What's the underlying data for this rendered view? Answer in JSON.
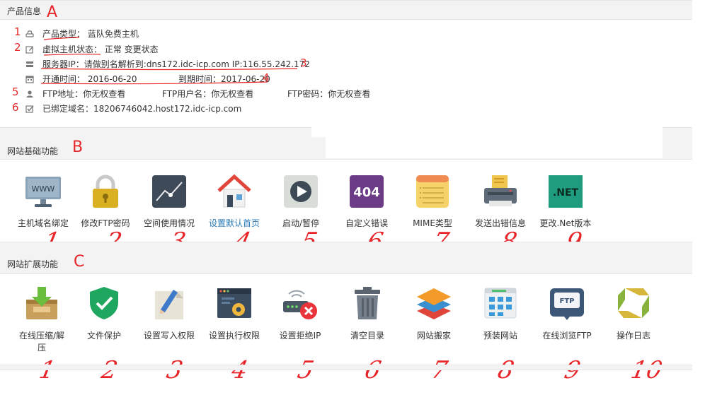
{
  "section_a": {
    "title": "产品信息",
    "letter": "A",
    "rows": [
      {
        "num": "1",
        "icon": "drive-icon",
        "text": "产品类型： 蓝队免费主机"
      },
      {
        "num": "2",
        "icon": "edit-icon",
        "text": "虚拟主机状态： 正常 变更状态"
      },
      {
        "num": "",
        "icon": "server-icon",
        "text": "服务器IP：请做别名解析到:dns172.idc-icp.com IP:116.55.242.172",
        "after_num": "3"
      },
      {
        "num": "",
        "icon": "calendar-icon",
        "text": "开通时间： 2016-06-20",
        "text2": "到期时间：2017-06-20",
        "after_num": "4"
      },
      {
        "num": "5",
        "icon": "user-icon",
        "text": "FTP地址：你无权查看",
        "text2": "FTP用户名：你无权查看",
        "text3": "FTP密码：你无权查看"
      },
      {
        "num": "6",
        "icon": "check-square-icon",
        "text": "已绑定域名：18206746042.host172.idc-icp.com"
      }
    ]
  },
  "section_b": {
    "title": "网站基础功能",
    "letter": "B",
    "tiles": [
      {
        "label": "主机域名绑定",
        "hand": "1",
        "icon": "www-monitor-icon",
        "link": false
      },
      {
        "label": "修改FTP密码",
        "hand": "2",
        "icon": "padlock-icon",
        "link": false
      },
      {
        "label": "空间使用情况",
        "hand": "3",
        "icon": "chart-icon",
        "link": false
      },
      {
        "label": "设置默认首页",
        "hand": "4",
        "icon": "home-icon",
        "link": true
      },
      {
        "label": "启动/暂停",
        "hand": "5",
        "icon": "play-icon",
        "link": false
      },
      {
        "label": "自定义错误",
        "hand": "6",
        "icon": "error-404-icon",
        "link": false
      },
      {
        "label": "MIME类型",
        "hand": "7",
        "icon": "notepad-icon",
        "link": false
      },
      {
        "label": "发送出错信息",
        "hand": "8",
        "icon": "printer-icon",
        "link": false
      },
      {
        "label": "更改.Net版本",
        "hand": "9",
        "icon": "dotnet-icon",
        "link": false
      }
    ],
    "tile_texts": {
      "www": "WWW",
      "e404": "404",
      "net": ".NET"
    }
  },
  "section_c": {
    "title": "网站扩展功能",
    "letter": "C",
    "tiles": [
      {
        "label": "在线压缩/解压",
        "hand": "1",
        "icon": "archive-download-icon"
      },
      {
        "label": "文件保护",
        "hand": "2",
        "icon": "shield-check-icon"
      },
      {
        "label": "设置写入权限",
        "hand": "3",
        "icon": "pencil-doc-icon"
      },
      {
        "label": "设置执行权限",
        "hand": "4",
        "icon": "gear-window-icon"
      },
      {
        "label": "设置拒绝IP",
        "hand": "5",
        "icon": "router-deny-icon"
      },
      {
        "label": "清空目录",
        "hand": "6",
        "icon": "trash-icon"
      },
      {
        "label": "网站搬家",
        "hand": "7",
        "icon": "layers-icon"
      },
      {
        "label": "预装网站",
        "hand": "8",
        "icon": "grid-window-icon"
      },
      {
        "label": "在线浏览FTP",
        "hand": "9",
        "icon": "ftp-browser-icon"
      },
      {
        "label": "操作日志",
        "hand": "10",
        "icon": "recycle-log-icon"
      }
    ],
    "tile_texts": {
      "ftp": "FTP"
    }
  }
}
